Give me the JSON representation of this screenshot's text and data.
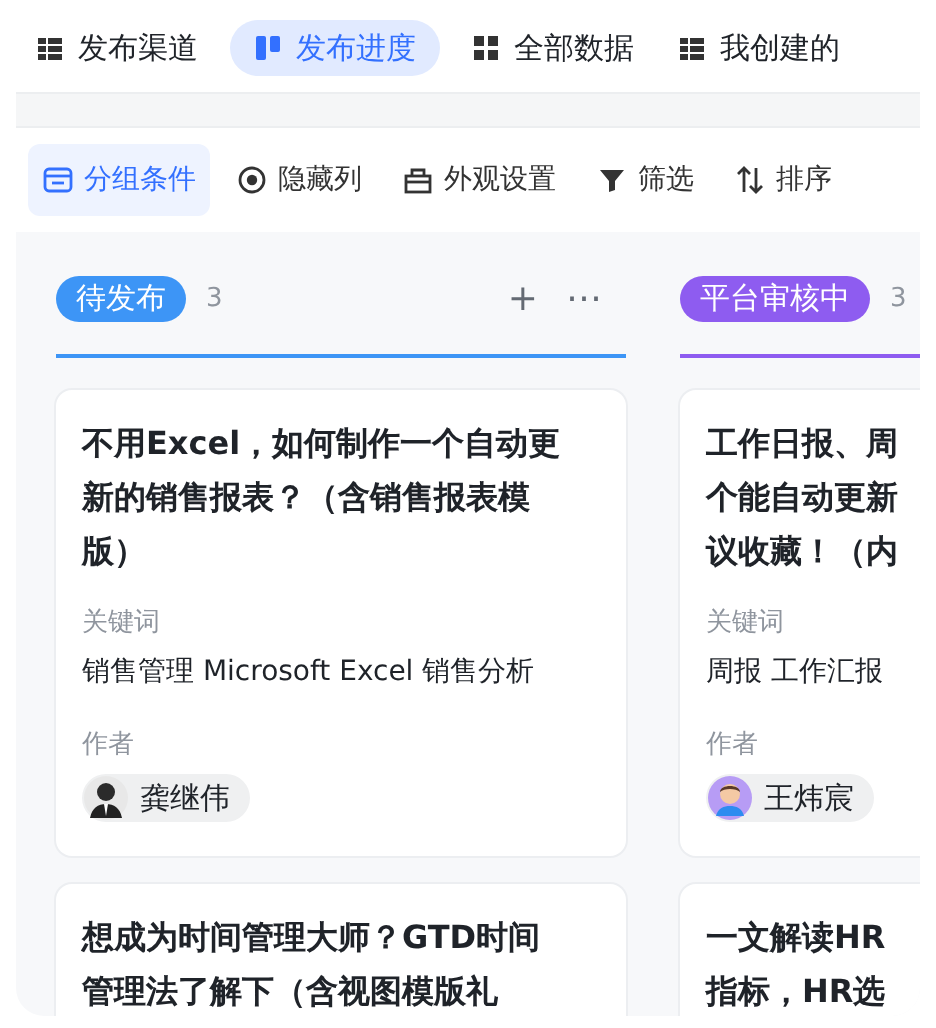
{
  "view_tabs": [
    {
      "label": "发布渠道",
      "selected": false
    },
    {
      "label": "发布进度",
      "selected": true
    },
    {
      "label": "全部数据",
      "selected": false
    },
    {
      "label": "我创建的",
      "selected": false
    }
  ],
  "toolbar": [
    {
      "label": "分组条件",
      "selected": true
    },
    {
      "label": "隐藏列",
      "selected": false
    },
    {
      "label": "外观设置",
      "selected": false
    },
    {
      "label": "筛选",
      "selected": false
    },
    {
      "label": "排序",
      "selected": false
    }
  ],
  "columns": [
    {
      "label": "待发布",
      "count": "3",
      "color": "#3d95f6",
      "actions": [
        "+",
        "⋯"
      ],
      "cards": [
        {
          "title_lines": [
            "不用Excel，如何制作一个自动更",
            "新的销售报表？（含销售报表模",
            "版）"
          ],
          "keywords_label": "关键词",
          "keywords": "销售管理 Microsoft Excel 销售分析",
          "author_label": "作者",
          "author": "龚继伟"
        },
        {
          "title_lines": [
            "想成为时间管理大师？GTD时间",
            "管理法了解下（含视图模版礼"
          ]
        }
      ]
    },
    {
      "label": "平台审核中",
      "count": "3",
      "color": "#8e5cf0",
      "cards": [
        {
          "title_lines": [
            "工作日报、周",
            "个能自动更新",
            "议收藏！（内"
          ],
          "keywords_label": "关键词",
          "keywords": "周报 工作汇报",
          "author_label": "作者",
          "author": "王炜宸"
        },
        {
          "title_lines": [
            "一文解读HR",
            "指标，HR选"
          ]
        }
      ]
    }
  ]
}
